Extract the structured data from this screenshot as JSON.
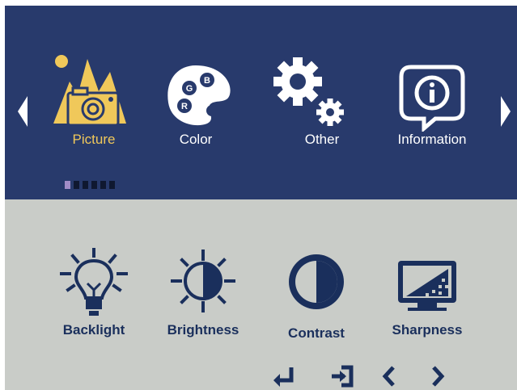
{
  "categories": [
    {
      "label": "Picture",
      "icon": "picture-mountains-camera-icon",
      "active": true
    },
    {
      "label": "Color",
      "icon": "color-palette-icon",
      "active": false
    },
    {
      "label": "Other",
      "icon": "gears-icon",
      "active": false
    },
    {
      "label": "Information",
      "icon": "information-bubble-icon",
      "active": false
    }
  ],
  "palette_letters": {
    "g": "G",
    "b": "B",
    "r": "R"
  },
  "page_indicator": {
    "total": 6,
    "current": 1
  },
  "sub_items": [
    {
      "label": "Backlight",
      "icon": "lightbulb-icon"
    },
    {
      "label": "Brightness",
      "icon": "sun-half-icon"
    },
    {
      "label": "Contrast",
      "icon": "contrast-circle-icon"
    },
    {
      "label": "Sharpness",
      "icon": "monitor-sharpness-icon"
    }
  ],
  "nav_buttons": [
    "enter-icon",
    "exit-icon",
    "left-chevron-icon",
    "right-chevron-icon"
  ],
  "colors": {
    "top_bg": "#283a6c",
    "bottom_bg": "#c9ccc8",
    "accent": "#f0c85a",
    "sub_text": "#1a2f5c",
    "indicator_on": "#a18cc7"
  }
}
